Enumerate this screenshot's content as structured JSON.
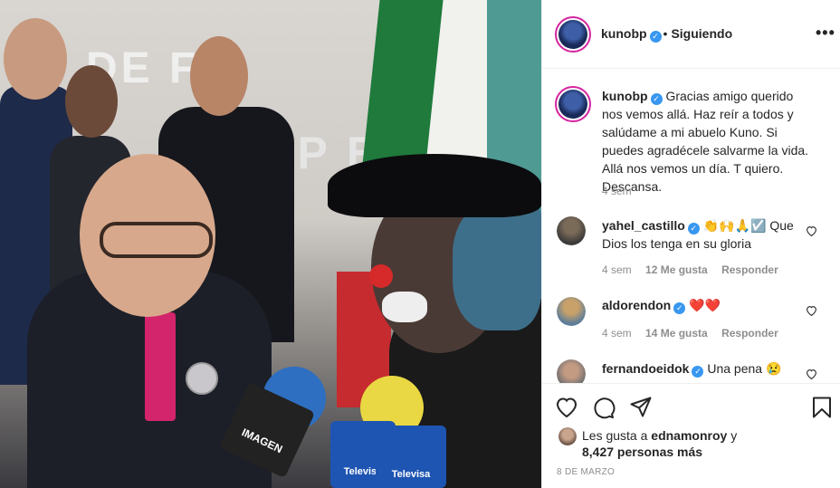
{
  "photo": {
    "banner_top": "DE F",
    "banner_mid": "OMP ESO",
    "mic_left_brand": "IMAGEN",
    "mic_right_brand": "Televisa",
    "mic_right_brand2": "Televisa"
  },
  "post": {
    "author": "kunobp",
    "verified_mark": "✓",
    "separator": "•",
    "follow_state": "Siguiendo",
    "more_label": "•••",
    "caption": {
      "username": "kunobp",
      "text": "Gracias amigo querido nos vemos allá. Haz reír a todos y salúdame a mi abuelo Kuno. Si puedes agradécele salvarme la vida. Allá nos vemos un día. T quiero. Descansa.",
      "time": "4 sem"
    },
    "comments": [
      {
        "username": "yahel_castillo",
        "text": "👏🙌🙏☑️ Que Dios los tenga en su gloria",
        "time": "4 sem",
        "likes": "12 Me gusta",
        "reply": "Responder"
      },
      {
        "username": "aldorendon",
        "text": "❤️❤️",
        "time": "4 sem",
        "likes": "14 Me gusta",
        "reply": "Responder"
      },
      {
        "username": "fernandoeidok",
        "text": "Una pena 😢",
        "time": "",
        "likes": "",
        "reply": ""
      }
    ],
    "liked_by_prefix": "Les gusta a",
    "liked_by_user": "ednamonroy",
    "liked_by_suffix": "y",
    "others_count": "8,427 personas más",
    "date": "8 DE MARZO"
  },
  "icons": {
    "like": "heart-outline-icon",
    "comment": "comment-bubble-icon",
    "share": "paper-plane-icon",
    "save": "bookmark-icon",
    "comment_like": "heart-outline-icon",
    "more": "more-options-icon"
  },
  "colors": {
    "verified": "#3897f0",
    "text": "#262626",
    "secondary": "#8e8e8e",
    "story_ring": "#d6249f"
  }
}
